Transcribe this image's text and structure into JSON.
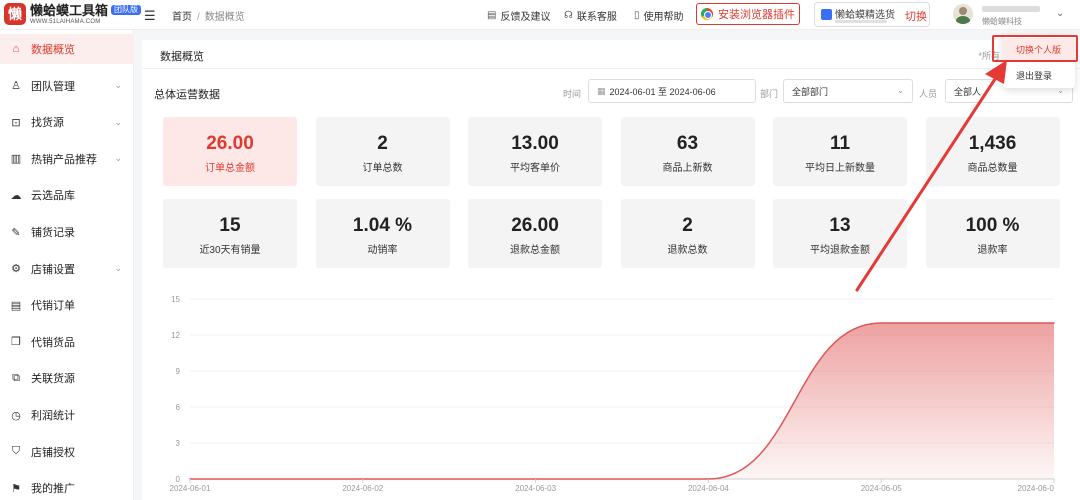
{
  "header": {
    "logo_mark": "懒",
    "logo_title": "懒蛤蟆工具箱",
    "logo_badge": "团队版",
    "logo_url": "WWW.51LAIHAMA.COM",
    "breadcrumb_home": "首页",
    "breadcrumb_sep": "/",
    "breadcrumb_current": "数据概览",
    "feedback": "反馈及建议",
    "support": "联系客服",
    "help": "使用帮助",
    "install": "安装浏览器插件",
    "shop_name": "懒蛤蟆精选货源",
    "shop_progress": 1.0,
    "switch": "切换",
    "user_company": "懒蛤蟆科技"
  },
  "sidebar": {
    "items": [
      {
        "label": "数据概览",
        "icon": "home-icon",
        "active": true,
        "has_children": false
      },
      {
        "label": "团队管理",
        "icon": "team-icon",
        "active": false,
        "has_children": true
      },
      {
        "label": "找货源",
        "icon": "search-goods-icon",
        "active": false,
        "has_children": true
      },
      {
        "label": "热销产品推荐",
        "icon": "chart-bar-icon",
        "active": false,
        "has_children": true
      },
      {
        "label": "云选品库",
        "icon": "cloud-icon",
        "active": false,
        "has_children": false
      },
      {
        "label": "铺货记录",
        "icon": "record-icon",
        "active": false,
        "has_children": false
      },
      {
        "label": "店铺设置",
        "icon": "store-settings-icon",
        "active": false,
        "has_children": true
      },
      {
        "label": "代销订单",
        "icon": "order-icon",
        "active": false,
        "has_children": false
      },
      {
        "label": "代销货品",
        "icon": "box-icon",
        "active": false,
        "has_children": false
      },
      {
        "label": "关联货源",
        "icon": "link-icon",
        "active": false,
        "has_children": false
      },
      {
        "label": "利润统计",
        "icon": "clock-icon",
        "active": false,
        "has_children": false
      },
      {
        "label": "店铺授权",
        "icon": "shield-icon",
        "active": false,
        "has_children": false
      },
      {
        "label": "我的推广",
        "icon": "promote-icon",
        "active": false,
        "has_children": false
      }
    ]
  },
  "main": {
    "title": "数据概览",
    "note": "*所有",
    "section_title": "总体运营数据",
    "filters": {
      "time_label": "时间",
      "date_range": "2024-06-01 至 2024-06-06",
      "dept_label": "部门",
      "dept_value": "全部部门",
      "person_label": "人员",
      "person_value": "全部人"
    },
    "stats": [
      {
        "value": "26.00",
        "label": "订单总金额",
        "highlight": true
      },
      {
        "value": "2",
        "label": "订单总数",
        "highlight": false
      },
      {
        "value": "13.00",
        "label": "平均客单价",
        "highlight": false
      },
      {
        "value": "63",
        "label": "商品上新数",
        "highlight": false
      },
      {
        "value": "11",
        "label": "平均日上新数量",
        "highlight": false
      },
      {
        "value": "1,436",
        "label": "商品总数量",
        "highlight": false
      },
      {
        "value": "15",
        "label": "近30天有销量",
        "highlight": false
      },
      {
        "value": "1.04 %",
        "label": "动销率",
        "highlight": false
      },
      {
        "value": "26.00",
        "label": "退款总金额",
        "highlight": false
      },
      {
        "value": "2",
        "label": "退款总数",
        "highlight": false
      },
      {
        "value": "13",
        "label": "平均退款金额",
        "highlight": false
      },
      {
        "value": "100 %",
        "label": "退款率",
        "highlight": false
      }
    ]
  },
  "dropdown": {
    "items": [
      "切换个人版",
      "退出登录"
    ]
  },
  "chart_data": {
    "type": "area",
    "x": [
      "2024-06-01",
      "2024-06-02",
      "2024-06-03",
      "2024-06-04",
      "2024-06-05",
      "2024-06-06"
    ],
    "xtick_labels": [
      "2024-06-01",
      "2024-06-02",
      "2024-06-03",
      "2024-06-04",
      "2024-06-05",
      "2024-06-0"
    ],
    "values": [
      0,
      0,
      0,
      0,
      13,
      13
    ],
    "yticks": [
      "15",
      "12",
      "9",
      "6",
      "3",
      "0"
    ],
    "ylim": [
      0,
      15
    ],
    "grid": true,
    "color": "#e05555"
  },
  "colors": {
    "accent": "#e03a2f",
    "highlight_bg": "#fde7e7",
    "card_bg": "#f4f4f5"
  }
}
